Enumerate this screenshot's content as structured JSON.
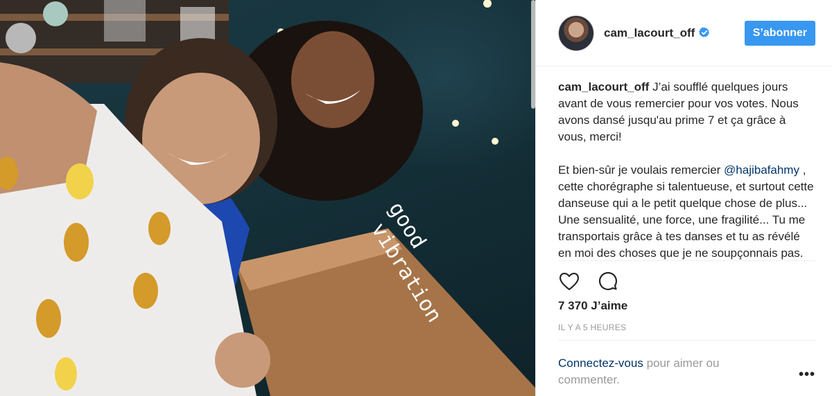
{
  "post": {
    "image_alt": "",
    "username": "cam_lacourt_off",
    "verified": true,
    "follow_label": "S’abonner",
    "caption": {
      "author": "cam_lacourt_off",
      "paragraph1": "J’ai soufflé quelques jours avant de vous remercier pour vos votes. Nous avons dansé jusqu'au prime 7 et ça grâce à vous, merci!",
      "paragraph2_before": "Et bien-sûr je voulais remercier",
      "mention": "@hajibafahmy",
      "paragraph2_after": ", cette chorégraphe si talentueuse, et surtout cette danseuse qui a le petit quelque chose de plus... Une sensualité, une force, une fragilité... Tu me transportais grâce à tes danses et tu as révélé en moi des choses que je ne soupçonnais pas."
    },
    "likes": "7 370 J’aime",
    "time_ago": "IL Y A 5 HEURES",
    "login_prompt": {
      "link": "Connectez-vous",
      "text": " pour aimer ou commenter."
    },
    "more_label": "•••",
    "neon_line1": "good",
    "neon_line2": "vibration"
  },
  "icons": {
    "like": "heart-icon",
    "comment": "comment-icon",
    "verified": "verified-badge-icon"
  },
  "colors": {
    "follow_button": "#3897f0",
    "link": "#003569",
    "text": "#262626",
    "muted": "#999999"
  }
}
